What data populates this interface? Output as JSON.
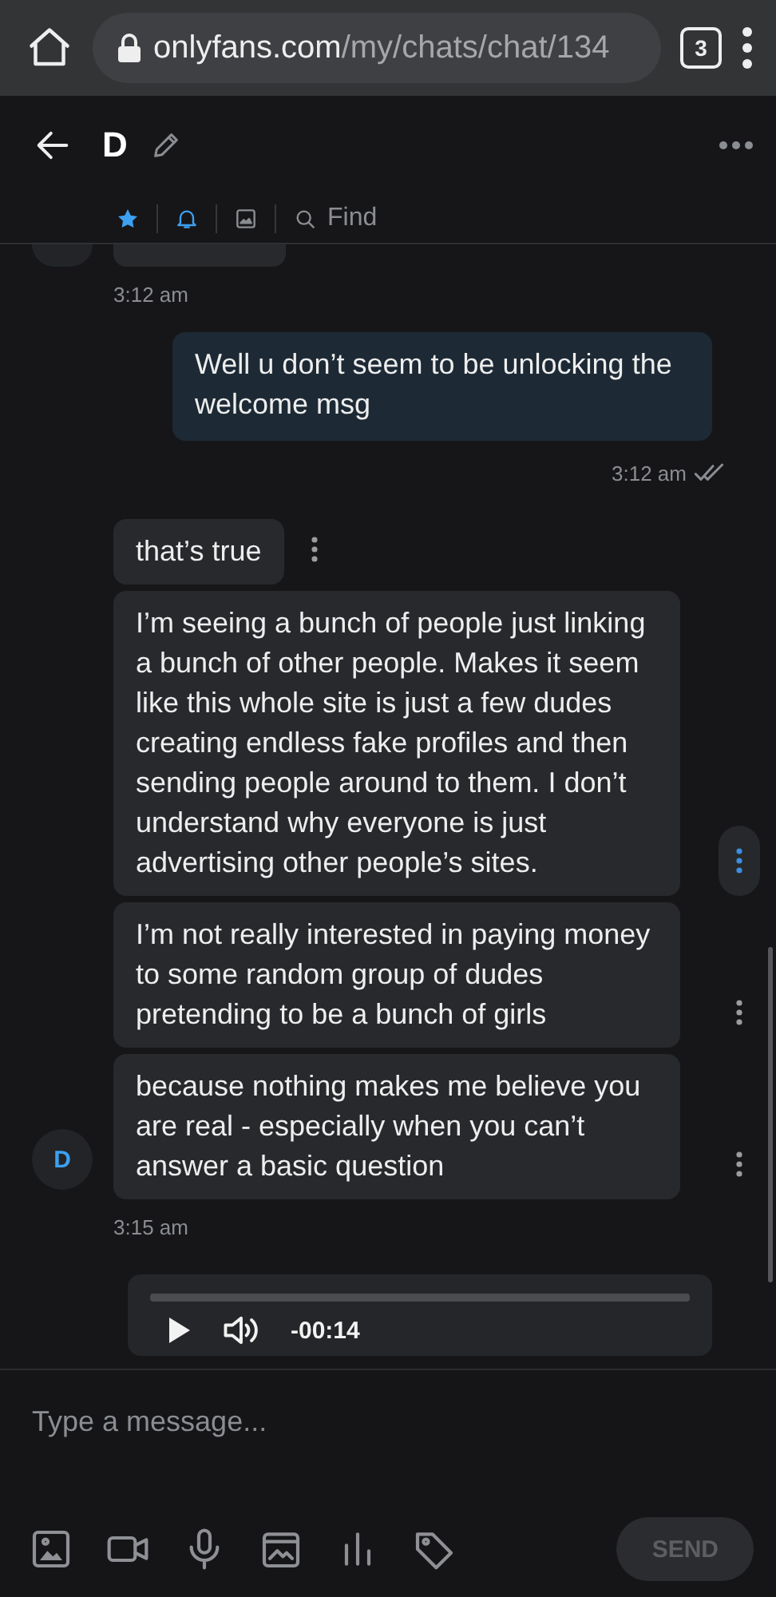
{
  "browser": {
    "url_host": "onlyfans.com",
    "url_path": "/my/chats/chat/134",
    "tab_count": "3"
  },
  "chat_header": {
    "title": "D",
    "toolbar": [
      {
        "kind": "star",
        "on": true
      },
      {
        "kind": "bell",
        "on": true
      },
      {
        "kind": "media",
        "on": false
      },
      {
        "kind": "find",
        "label": "Find",
        "on": false
      }
    ]
  },
  "messages": [
    {
      "outgoing": false,
      "kind": "fragment",
      "time": "3:12 am"
    },
    {
      "outgoing": true,
      "kind": "text",
      "text": "Well u don’t seem to be unlocking the welcome msg",
      "time": "3:12 am",
      "read": true
    },
    {
      "outgoing": false,
      "kind": "text",
      "text": "that’s true",
      "menu_active": false
    },
    {
      "outgoing": false,
      "kind": "text",
      "text": "I’m seeing a bunch of people just linking a bunch of other people. Makes it seem like this whole site is just a few dudes creating endless fake profiles and then sending people around to them. I don’t understand why everyone is just advertising other people’s sites.",
      "menu_active": true
    },
    {
      "outgoing": false,
      "kind": "text",
      "text": "I’m not really interested in paying money to some random group of dudes pretending to be a bunch of girls",
      "menu_active": false
    },
    {
      "outgoing": false,
      "kind": "text",
      "text": "because nothing makes me believe you are real - especially when you can’t answer a basic question",
      "menu_active": false,
      "avatar": "D",
      "time": "3:15 am"
    },
    {
      "outgoing": true,
      "kind": "audio",
      "duration": "-00:14"
    }
  ],
  "composer": {
    "placeholder": "Type a message...",
    "tools": [
      {
        "kind": "image"
      },
      {
        "kind": "video"
      },
      {
        "kind": "mic"
      },
      {
        "kind": "vault"
      },
      {
        "kind": "poll"
      },
      {
        "kind": "tag"
      }
    ],
    "send_button": {
      "label": "SEND",
      "disabled": true
    }
  }
}
